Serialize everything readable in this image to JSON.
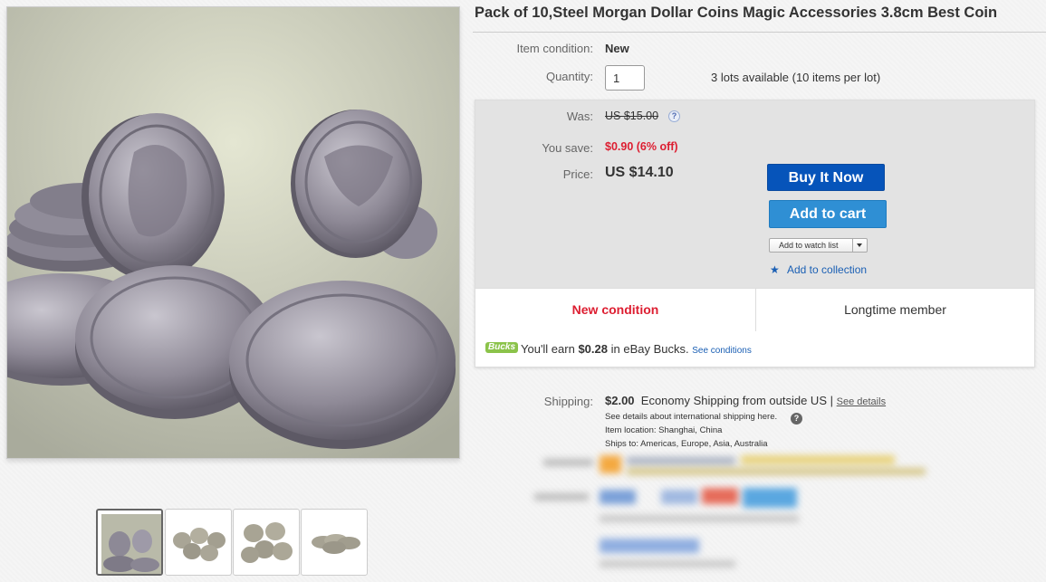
{
  "listing": {
    "title": "Pack of 10,Steel Morgan Dollar Coins Magic Accessories 3.8cm Best Coin"
  },
  "details": {
    "condition_label": "Item condition:",
    "condition_value": "New",
    "quantity_label": "Quantity:",
    "quantity_value": "1",
    "availability": "3 lots available (10 items per lot)"
  },
  "pricing": {
    "was_label": "Was:",
    "was_value": "US $15.00",
    "save_label": "You save:",
    "save_value": "$0.90 (6% off)",
    "price_label": "Price:",
    "price_value": "US $14.10"
  },
  "actions": {
    "buy_now": "Buy It Now",
    "add_to_cart": "Add to cart",
    "watch_list": "Add to watch list",
    "add_collection": "Add to collection"
  },
  "badges": {
    "left": "New condition",
    "right": "Longtime member"
  },
  "bucks": {
    "logo": "Bucks",
    "text_pre": "You'll earn ",
    "amount": "$0.28",
    "text_post": " in eBay Bucks.",
    "link": "See conditions"
  },
  "shipping": {
    "label": "Shipping:",
    "cost": "$2.00",
    "method": "Economy Shipping from outside US",
    "sep": "|",
    "details_link": "See details",
    "intl_note": "See details about international shipping here.",
    "location": "Item location:  Shanghai, China",
    "ships_to": "Ships to:  Americas, Europe, Asia, Australia"
  },
  "colors": {
    "buy_now": "#0654ba",
    "add_to_cart": "#2f8fd4",
    "discount_red": "#dd1e31",
    "link_blue": "#1a5fb4"
  },
  "icons": [
    "help-icon",
    "star-icon",
    "chevron-down-icon"
  ]
}
